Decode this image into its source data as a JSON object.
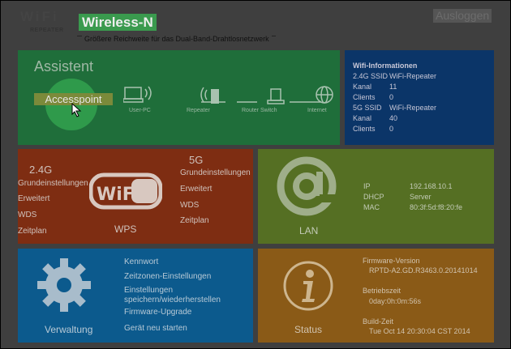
{
  "header": {
    "logo_text": "WiFi",
    "logo_sub": "REPEATER",
    "brand": "Wireless-N",
    "subtitle": "Größere Reichweite für das Dual-Band-Drahtlosnetzwerk",
    "logout": "Ausloggen"
  },
  "assistant": {
    "title": "Assistent",
    "selected": "Accesspoint",
    "diagram": [
      "User-PC",
      "Repeater",
      "Router Switch",
      "Internet"
    ]
  },
  "wifi_info": {
    "heading": "Wifi-Informationen",
    "rows": [
      {
        "k": "2.4G SSID",
        "v": "WiFi-Repeater"
      },
      {
        "k": "Kanal",
        "v": "11"
      },
      {
        "k": "Clients",
        "v": "0"
      },
      {
        "k": "5G SSID",
        "v": "WiFi-Repeater"
      },
      {
        "k": "Kanal",
        "v": "40"
      },
      {
        "k": "Clients",
        "v": "0"
      }
    ]
  },
  "wireless": {
    "band_24": "2.4G",
    "band_5": "5G",
    "items_24": [
      "Grundeinstellungen",
      "Erweitert",
      "WDS",
      "Zeitplan"
    ],
    "items_5": [
      "Grundeinstellungen",
      "Erweitert",
      "WDS",
      "Zeitplan"
    ],
    "logo_text": "WiFi",
    "wps": "WPS"
  },
  "lan": {
    "label": "LAN",
    "rows": [
      {
        "k": "IP",
        "v": "192.168.10.1"
      },
      {
        "k": "DHCP",
        "v": "Server"
      },
      {
        "k": "MAC",
        "v": "80:3f:5d:f8:20:fe"
      }
    ]
  },
  "management": {
    "label": "Verwaltung",
    "items": [
      "Kennwort",
      "Zeitzonen-Einstellungen",
      "Einstellungen",
      "speichern/wiederherstellen",
      "Firmware-Upgrade",
      "Gerät neu starten"
    ]
  },
  "status": {
    "label": "Status",
    "firmware_label": "Firmware-Version",
    "firmware": "RPTD-A2.GD.R3463.0.20141014",
    "uptime_label": "Betriebszeit",
    "uptime": "0day:0h:0m:56s",
    "build_label": "Build-Zeit",
    "build": "Tue Oct 14 20:30:04 CST 2014"
  }
}
